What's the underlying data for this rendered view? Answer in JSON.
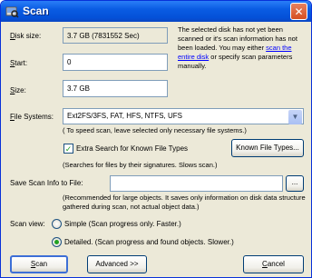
{
  "window": {
    "title": "Scan"
  },
  "form": {
    "disk_size_label": "Disk size:",
    "disk_size_value": "3.7 GB (7831552 Sec)",
    "start_label": "Start:",
    "start_value": "0",
    "size_label": "Size:",
    "size_value": "3.7 GB",
    "file_systems_label": "File Systems:",
    "file_systems_value": "Ext2FS/3FS, FAT, HFS, NTFS, UFS",
    "file_systems_note": "( To speed scan, leave selected only necessary file systems.)",
    "extra_search_label": "Extra Search for Known File Types",
    "extra_search_checked": true,
    "known_types_button": "Known File Types...",
    "extra_search_note": "(Searches for files by their signatures. Slows scan.)",
    "save_label": "Save Scan Info to File:",
    "save_value": "",
    "browse_button": "...",
    "save_note": "(Recommended for large objects. It saves only information on disk data structure gathered during scan, not actual object data.)",
    "scan_view_label": "Scan view:",
    "simple_label": "Simple (Scan progress only. Faster.)",
    "detailed_label": "Detailed. (Scan progress and found objects. Slower.)"
  },
  "info": {
    "text_before": "The selected disk has not yet been scanned or it's scan information has not been loaded. You may either",
    "link": "scan the entire disk",
    "text_after": "or specify scan parameters manually."
  },
  "buttons": {
    "scan": "Scan",
    "advanced": "Advanced >>",
    "cancel": "Cancel"
  }
}
